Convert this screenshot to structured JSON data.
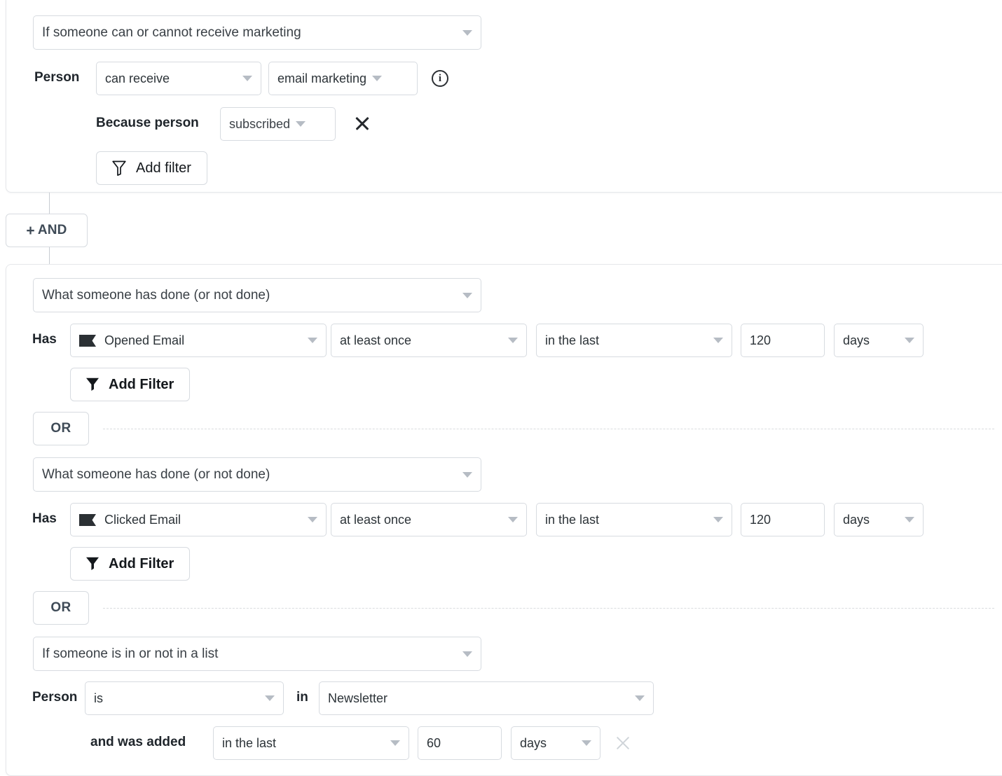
{
  "groups": [
    {
      "id": "group-marketing",
      "type_select": {
        "value": "If someone can or cannot receive marketing",
        "icon": "chevron-down-icon"
      },
      "row": {
        "subject_label": "Person",
        "ability_select": "can receive",
        "channel_select": "email marketing",
        "info_icon": "info-icon",
        "info_glyph": "i"
      },
      "reason_row": {
        "label": "Because person",
        "reason_select": "subscribed",
        "remove_icon": "close-icon"
      },
      "add_filter": {
        "label": "Add filter",
        "icon": "funnel-outline-icon"
      }
    }
  ],
  "connector": {
    "and_button": {
      "label": "AND",
      "plus": "+",
      "icon": "plus-icon"
    }
  },
  "second_group": {
    "blocks": [
      {
        "id": "block-opened-email",
        "type_select": {
          "value": "What someone has done (or not done)",
          "icon": "chevron-down-icon"
        },
        "condition_row": {
          "prefix_label": "Has",
          "metric": {
            "value": "Opened Email",
            "icon": "flag-icon"
          },
          "frequency": "at least once",
          "timeframe": "in the last",
          "amount": "120",
          "unit": "days"
        },
        "add_filter": {
          "label": "Add Filter",
          "icon": "funnel-solid-icon"
        }
      },
      {
        "id": "block-clicked-email",
        "type_select": {
          "value": "What someone has done (or not done)",
          "icon": "chevron-down-icon"
        },
        "condition_row": {
          "prefix_label": "Has",
          "metric": {
            "value": "Clicked Email",
            "icon": "flag-icon"
          },
          "frequency": "at least once",
          "timeframe": "in the last",
          "amount": "120",
          "unit": "days"
        },
        "add_filter": {
          "label": "Add Filter",
          "icon": "funnel-solid-icon"
        }
      },
      {
        "id": "block-list-membership",
        "type_select": {
          "value": "If someone is in or not in a list",
          "icon": "chevron-down-icon"
        },
        "membership_row": {
          "subject_label": "Person",
          "operator": "is",
          "joiner_label": "in",
          "list_name": "Newsletter"
        },
        "added_row": {
          "label": "and was added",
          "timeframe": "in the last",
          "amount": "60",
          "unit": "days",
          "remove_icon": "close-icon"
        }
      }
    ],
    "or_dividers": [
      {
        "label": "OR"
      },
      {
        "label": "OR"
      }
    ]
  },
  "colors": {
    "border": "#d7dbe0",
    "card_border": "#e6e8eb",
    "text": "#2c3338",
    "label_text": "#1f252b",
    "muted": "#b6bcc4",
    "dash": "#d9dcdf",
    "flag": "#2b3034"
  }
}
